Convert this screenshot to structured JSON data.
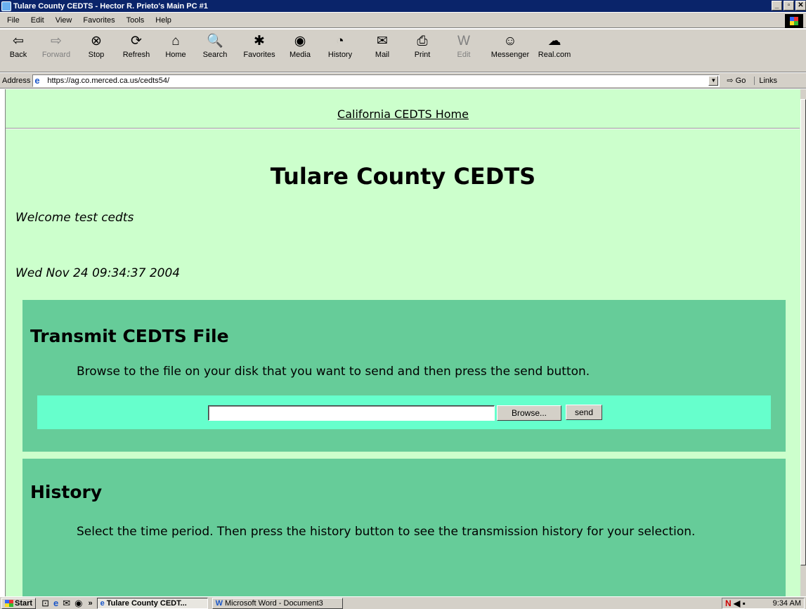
{
  "window": {
    "title": "Tulare County CEDTS - Hector R. Prieto's Main PC #1",
    "controls": [
      "_",
      "▫",
      "✕"
    ]
  },
  "menu": [
    "File",
    "Edit",
    "View",
    "Favorites",
    "Tools",
    "Help"
  ],
  "toolbar": [
    {
      "id": "back",
      "label": "Back",
      "glyph": "⇦"
    },
    {
      "id": "forward",
      "label": "Forward",
      "glyph": "⇨"
    },
    {
      "id": "stop",
      "label": "Stop",
      "glyph": "⊗"
    },
    {
      "id": "refresh",
      "label": "Refresh",
      "glyph": "⟳"
    },
    {
      "id": "home",
      "label": "Home",
      "glyph": "⌂"
    },
    {
      "id": "search",
      "label": "Search",
      "glyph": "🔍"
    },
    {
      "id": "favorites",
      "label": "Favorites",
      "glyph": "✱"
    },
    {
      "id": "media",
      "label": "Media",
      "glyph": "◉"
    },
    {
      "id": "history",
      "label": "History",
      "glyph": "◔"
    },
    {
      "id": "mail",
      "label": "Mail",
      "glyph": "✉"
    },
    {
      "id": "print",
      "label": "Print",
      "glyph": "⎙"
    },
    {
      "id": "edit",
      "label": "Edit",
      "glyph": "W"
    },
    {
      "id": "messenger",
      "label": "Messenger",
      "glyph": "☺"
    },
    {
      "id": "realcom",
      "label": "Real.com",
      "glyph": "☁"
    }
  ],
  "address": {
    "label": "Address",
    "url": "https://ag.co.merced.ca.us/cedts54/",
    "go": "Go",
    "links": "Links"
  },
  "page": {
    "home_link": "California CEDTS Home",
    "title": "Tulare County CEDTS",
    "welcome": "Welcome test cedts",
    "date": "Wed Nov 24 09:34:37 2004",
    "transmit": {
      "heading": "Transmit CEDTS File",
      "instructions": "Browse to the file on your disk that you want to send and then press the send button.",
      "file_value": "",
      "browse_label": "Browse...",
      "send_label": "send"
    },
    "history": {
      "heading": "History",
      "instructions": "Select the time period. Then press the history button to see the transmission history for your selection."
    }
  },
  "taskbar": {
    "start": "Start",
    "chevron": "»",
    "tasks": [
      {
        "label": "Tulare County CEDT...",
        "active": true
      },
      {
        "label": "Microsoft Word - Document3",
        "active": false
      }
    ],
    "clock": "9:34 AM"
  }
}
